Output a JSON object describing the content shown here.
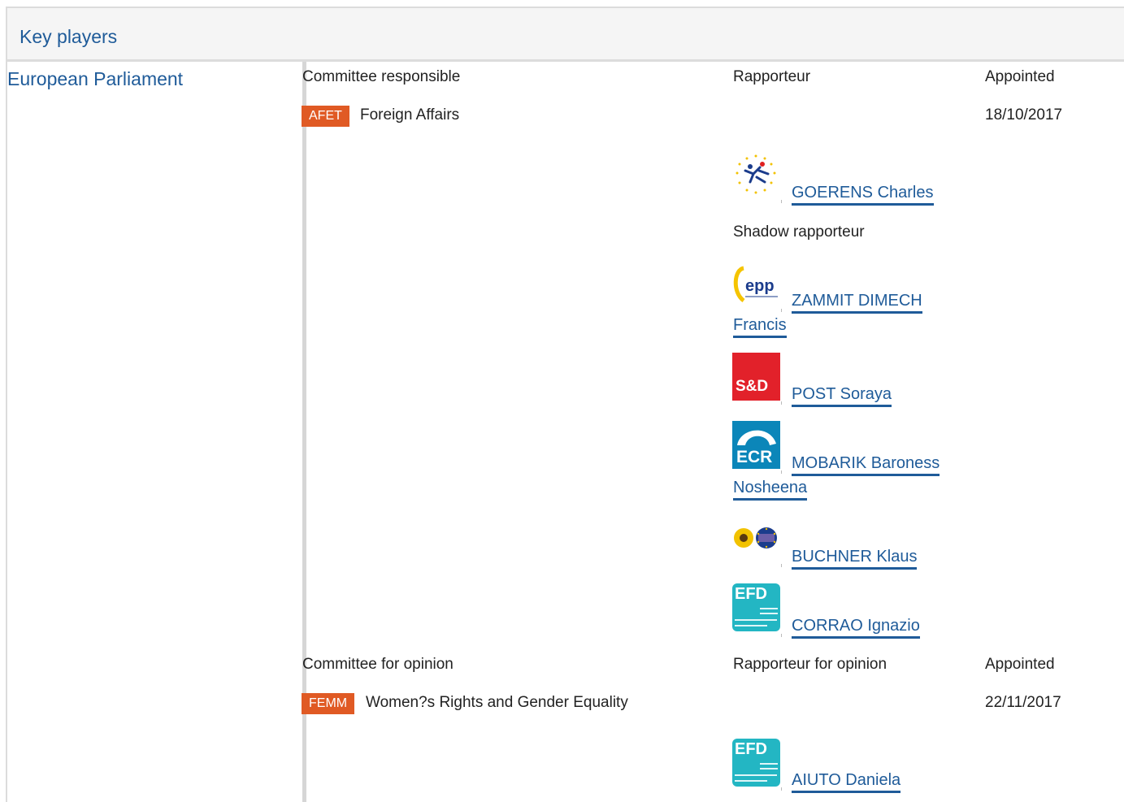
{
  "header": {
    "title": "Key players"
  },
  "institution": {
    "name": "European Parliament"
  },
  "responsible": {
    "heading": "Committee responsible",
    "rapporteur_heading": "Rapporteur",
    "appointed_heading": "Appointed",
    "committee": {
      "code": "AFET",
      "name": "Foreign Affairs",
      "color": "#e05a24"
    },
    "appointed": "18/10/2017",
    "rapporteur": {
      "name": "GOERENS Charles",
      "group_icon": "alde-logo-icon"
    },
    "shadow_heading": "Shadow rapporteur",
    "shadows": [
      {
        "name_line1": "ZAMMIT DIMECH",
        "name_line2": "Francis",
        "group_icon": "epp-logo-icon"
      },
      {
        "name_line1": "POST Soraya",
        "group_icon": "sd-logo-icon",
        "logo_text": "S&D"
      },
      {
        "name_line1": "MOBARIK Baroness",
        "name_line2": "Nosheena",
        "group_icon": "ecr-logo-icon",
        "logo_text": "ECR"
      },
      {
        "name_line1": "BUCHNER Klaus",
        "group_icon": "greens-efa-logo-icon"
      },
      {
        "name_line1": "CORRAO Ignazio",
        "group_icon": "efdd-logo-icon"
      }
    ]
  },
  "opinion": {
    "heading": "Committee for opinion",
    "rapporteur_heading": "Rapporteur for opinion",
    "appointed_heading": "Appointed",
    "committee": {
      "code": "FEMM",
      "name": "Women?s Rights and Gender Equality",
      "color": "#e05a24"
    },
    "appointed": "22/11/2017",
    "rapporteur": {
      "name": "AIUTO Daniela",
      "group_icon": "efdd-logo-icon"
    }
  },
  "colors": {
    "link": "#1f5b99",
    "badge": "#e05a24",
    "sd_red": "#e2212a",
    "ecr_blue": "#0b86b9",
    "efdd_teal": "#23b6c3"
  }
}
